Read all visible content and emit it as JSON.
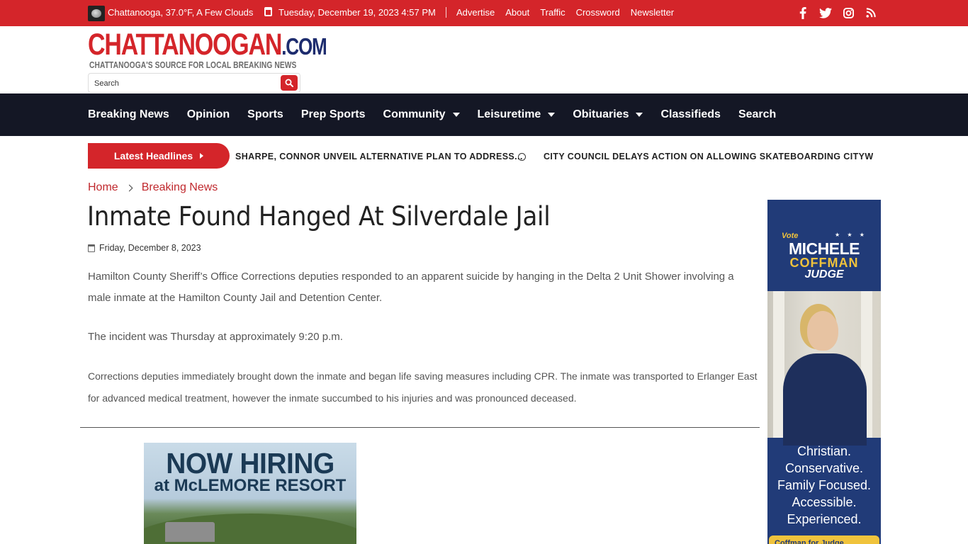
{
  "topbar": {
    "weather": "Chattanooga, 37.0°F, A Few Clouds",
    "date": "Tuesday, December 19, 2023 4:57 PM",
    "links": [
      "Advertise",
      "About",
      "Traffic",
      "Crossword",
      "Newsletter"
    ],
    "social_icons": [
      "facebook-icon",
      "twitter-icon",
      "instagram-icon",
      "rss-icon"
    ],
    "bg_color": "#d4252a"
  },
  "header": {
    "logo_main": "CHATTANOOGAN",
    "logo_com": ".COM",
    "tagline": "CHATTANOOGA'S SOURCE FOR LOCAL BREAKING NEWS",
    "search_placeholder": "Search"
  },
  "nav": {
    "items": [
      {
        "label": "Breaking News",
        "dropdown": false
      },
      {
        "label": "Opinion",
        "dropdown": false
      },
      {
        "label": "Sports",
        "dropdown": false
      },
      {
        "label": "Prep Sports",
        "dropdown": false
      },
      {
        "label": "Community",
        "dropdown": true
      },
      {
        "label": "Leisuretime",
        "dropdown": true
      },
      {
        "label": "Obituaries",
        "dropdown": true
      },
      {
        "label": "Classifieds",
        "dropdown": false
      },
      {
        "label": "Search",
        "dropdown": false
      }
    ],
    "bg_color": "#141725"
  },
  "ticker": {
    "button_label": "Latest Headlines",
    "headline_1": "SHARPE, CONNOR UNVEIL ALTERNATIVE PLAN TO ADDRESS...",
    "headline_2": "CITY COUNCIL DELAYS ACTION ON ALLOWING SKATEBOARDING CITYWIDE"
  },
  "breadcrumb": {
    "home": "Home",
    "section": "Breaking News"
  },
  "article": {
    "title": "Inmate Found Hanged At Silverdale Jail",
    "date": "Friday, December 8, 2023",
    "paragraphs": [
      "Hamilton County Sheriff’s Office Corrections deputies responded to an apparent suicide by hanging in the Delta 2 Unit Shower involving a male inmate at the Hamilton County Jail and Detention Center.",
      "The incident was Thursday at approximately 9:20 p.m.",
      "Corrections deputies immediately brought down the inmate and began life saving measures including CPR. The inmate was transported to Erlanger East for advanced medical treatment, however the inmate succumbed to his injuries and was pronounced deceased."
    ]
  },
  "ad_hiring": {
    "line1": "NOW HIRING",
    "line2": "at McLEMORE RESORT"
  },
  "ad_side": {
    "vote": "Vote",
    "stars": "★ ★ ★",
    "name_first": "MICHELE",
    "name_last": "COFFMAN",
    "office": "JUDGE",
    "slogan": [
      "Christian.",
      "Conservative.",
      "Family Focused.",
      "Accessible.",
      "Experienced."
    ],
    "cta": "Coffman for Judge"
  }
}
